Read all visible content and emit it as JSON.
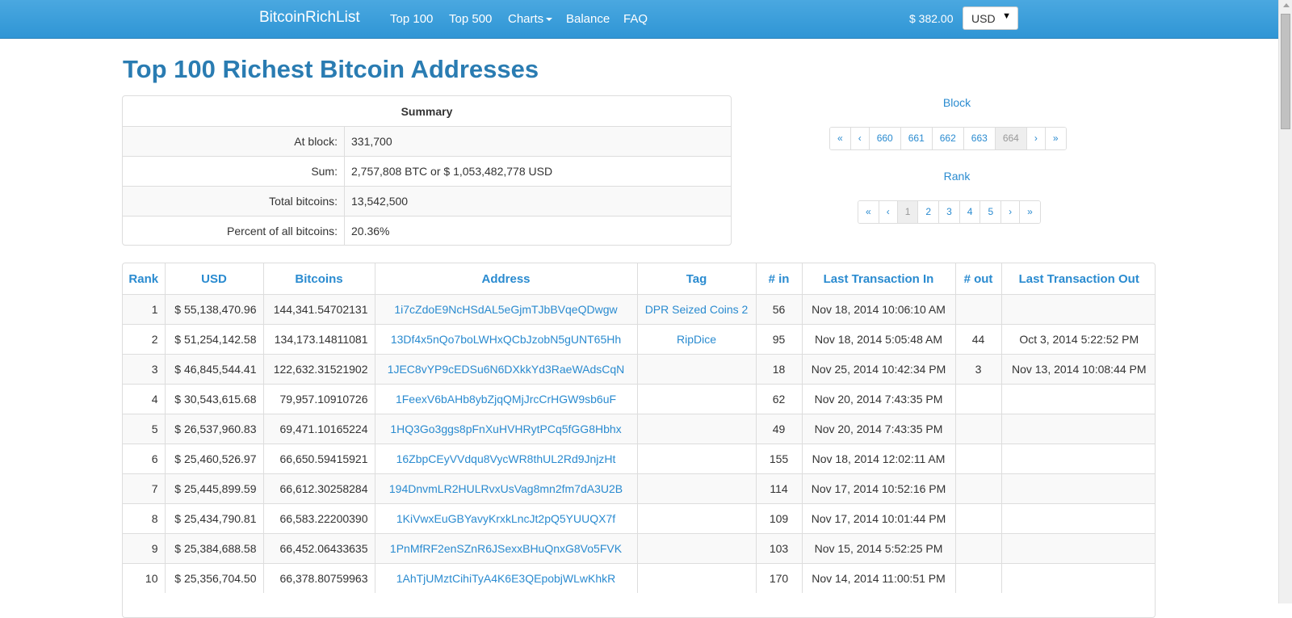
{
  "nav": {
    "brand": "BitcoinRichList",
    "links": [
      "Top 100",
      "Top 500",
      "Charts",
      "Balance",
      "FAQ"
    ],
    "price": "$ 382.00",
    "currency": "USD"
  },
  "title": "Top 100 Richest Bitcoin Addresses",
  "summary": {
    "header": "Summary",
    "rows": [
      {
        "label": "At block:",
        "value": "331,700"
      },
      {
        "label": "Sum:",
        "value": "2,757,808 BTC or $ 1,053,482,778 USD"
      },
      {
        "label": "Total bitcoins:",
        "value": "13,542,500"
      },
      {
        "label": "Percent of all bitcoins:",
        "value": "20.36%"
      }
    ]
  },
  "block_pager": {
    "label": "Block",
    "items": [
      "«",
      "‹",
      "660",
      "661",
      "662",
      "663",
      "664",
      "›",
      "»"
    ],
    "active": "664"
  },
  "rank_pager": {
    "label": "Rank",
    "items": [
      "«",
      "‹",
      "1",
      "2",
      "3",
      "4",
      "5",
      "›",
      "»"
    ],
    "active": "1"
  },
  "table": {
    "headers": [
      "Rank",
      "USD",
      "Bitcoins",
      "Address",
      "Tag",
      "# in",
      "Last Transaction In",
      "# out",
      "Last Transaction Out"
    ],
    "rows": [
      [
        "1",
        "$ 55,138,470.96",
        "144,341.54702131",
        "1i7cZdoE9NcHSdAL5eGjmTJbBVqeQDwgw",
        "DPR Seized Coins 2",
        "56",
        "Nov 18, 2014 10:06:10 AM",
        "",
        ""
      ],
      [
        "2",
        "$ 51,254,142.58",
        "134,173.14811081",
        "13Df4x5nQo7boLWHxQCbJzobN5gUNT65Hh",
        "RipDice",
        "95",
        "Nov 18, 2014 5:05:48 AM",
        "44",
        "Oct 3, 2014 5:22:52 PM"
      ],
      [
        "3",
        "$ 46,845,544.41",
        "122,632.31521902",
        "1JEC8vYP9cEDSu6N6DXkkYd3RaeWAdsCqN",
        "",
        "18",
        "Nov 25, 2014 10:42:34 PM",
        "3",
        "Nov 13, 2014 10:08:44 PM"
      ],
      [
        "4",
        "$ 30,543,615.68",
        "79,957.10910726",
        "1FeexV6bAHb8ybZjqQMjJrcCrHGW9sb6uF",
        "",
        "62",
        "Nov 20, 2014 7:43:35 PM",
        "",
        ""
      ],
      [
        "5",
        "$ 26,537,960.83",
        "69,471.10165224",
        "1HQ3Go3ggs8pFnXuHVHRytPCq5fGG8Hbhx",
        "",
        "49",
        "Nov 20, 2014 7:43:35 PM",
        "",
        ""
      ],
      [
        "6",
        "$ 25,460,526.97",
        "66,650.59415921",
        "16ZbpCEyVVdqu8VycWR8thUL2Rd9JnjzHt",
        "",
        "155",
        "Nov 18, 2014 12:02:11 AM",
        "",
        ""
      ],
      [
        "7",
        "$ 25,445,899.59",
        "66,612.30258284",
        "194DnvmLR2HULRvxUsVag8mn2fm7dA3U2B",
        "",
        "114",
        "Nov 17, 2014 10:52:16 PM",
        "",
        ""
      ],
      [
        "8",
        "$ 25,434,790.81",
        "66,583.22200390",
        "1KiVwxEuGBYavyKrxkLncJt2pQ5YUUQX7f",
        "",
        "109",
        "Nov 17, 2014 10:01:44 PM",
        "",
        ""
      ],
      [
        "9",
        "$ 25,384,688.58",
        "66,452.06433635",
        "1PnMfRF2enSZnR6JSexxBHuQnxG8Vo5FVK",
        "",
        "103",
        "Nov 15, 2014 5:52:25 PM",
        "",
        ""
      ],
      [
        "10",
        "$ 25,356,704.50",
        "66,378.80759963",
        "1AhTjUMztCihiTyA4K6E3QEpobjWLwKhkR",
        "",
        "170",
        "Nov 14, 2014 11:00:51 PM",
        "",
        ""
      ]
    ]
  }
}
